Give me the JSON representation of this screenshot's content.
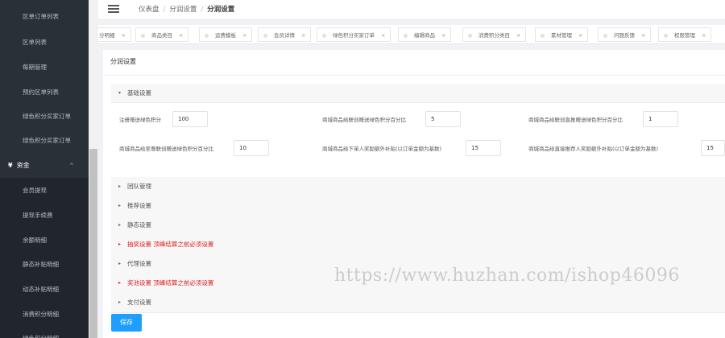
{
  "sidebar": {
    "items": [
      {
        "label": "区单订单列表"
      },
      {
        "label": "区单列表"
      },
      {
        "label": "每期管理"
      },
      {
        "label": "预约区单列表"
      },
      {
        "label": "绿色积分买家订单"
      },
      {
        "label": "绿色积分买家订单"
      }
    ],
    "group": {
      "icon": "¥",
      "label": "资金",
      "caret": "^"
    },
    "sub_items": [
      {
        "label": "会员提现"
      },
      {
        "label": "提现手续费"
      },
      {
        "label": "余额明细"
      },
      {
        "label": "静态补贴明细"
      },
      {
        "label": "动态补贴明细"
      },
      {
        "label": "消费积分明细"
      },
      {
        "label": "绿色积分明细"
      }
    ]
  },
  "header": {
    "breadcrumb": [
      "仪表盘",
      "分润设置",
      "分润设置"
    ]
  },
  "tabs": [
    {
      "label": "分明细"
    },
    {
      "label": "商品类目"
    },
    {
      "label": "运费模板"
    },
    {
      "label": "会员详情"
    },
    {
      "label": "绿色积分买家订单"
    },
    {
      "label": "编辑商品"
    },
    {
      "label": "消费积分类目"
    },
    {
      "label": "素材管理"
    },
    {
      "label": "问题反馈"
    },
    {
      "label": "权限管理"
    }
  ],
  "tab_close": "×",
  "panel": {
    "title": "分润设置",
    "basic": {
      "label": "基础设置",
      "fields": [
        {
          "label": "注册赠送绿色积分",
          "value": "100"
        },
        {
          "label": "商城商品给联创赠送绿色积分百分比",
          "value": "5"
        },
        {
          "label": "商城商品给联创直推赠送绿色积分百分比",
          "value": "1"
        },
        {
          "label": "商城商品给至尊联创赠送绿色积分百分比",
          "value": "10"
        },
        {
          "label": "商城商品给下单人奖励额外补贴(以订单金额为基数)",
          "value": "15"
        },
        {
          "label": "商城商品给直接推荐人奖励额外补贴(以订单金额为基数)",
          "value": "15"
        }
      ]
    },
    "sections": [
      {
        "label": "团队管理"
      },
      {
        "label": "推荐设置"
      },
      {
        "label": "静态设置"
      },
      {
        "label": "抽奖设置 顶峰结算之前必须设置"
      },
      {
        "label": "代理设置"
      },
      {
        "label": "奖池设置 顶峰结算之前必须设置"
      },
      {
        "label": "支付设置"
      }
    ],
    "save_label": "保存"
  },
  "watermark": "https://www.huzhan.com/ishop46096",
  "colors": {
    "sidebar_bg": "#293038",
    "primary": "#1e9fff",
    "warning_text": "#e02020"
  },
  "icons": {
    "collapsed": "▸",
    "expanded": "▾",
    "menu": "hamburger-icon"
  }
}
